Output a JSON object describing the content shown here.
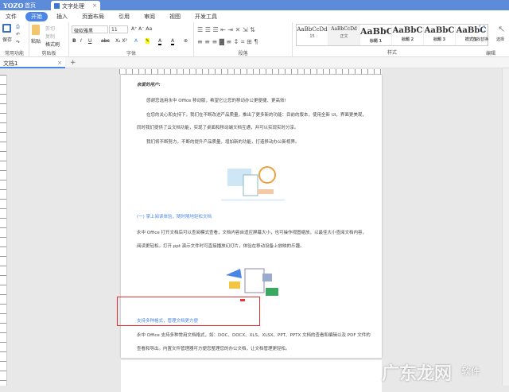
{
  "titlebar": {
    "logo": "YOZO",
    "home": "首页",
    "doc_tab": "文字处理"
  },
  "menu": [
    "文件",
    "开始",
    "插入",
    "页面布局",
    "引用",
    "审阅",
    "视图",
    "开发工具"
  ],
  "ribbon": {
    "common": {
      "save": "保存",
      "label": "常用功能"
    },
    "clipboard": {
      "paste": "粘贴",
      "cut": "剪切",
      "copy": "复制",
      "format_painter": "格式刷",
      "label": "剪贴板"
    },
    "font": {
      "name": "微软雅黑",
      "size": "11",
      "label": "字体"
    },
    "paragraph": {
      "label": "段落"
    },
    "styles": {
      "items": [
        {
          "preview": "AaBbCcDd",
          "name": "15"
        },
        {
          "preview": "AaBbCcDd",
          "name": "正文"
        },
        {
          "preview": "AaBbC",
          "name": "标题 1"
        },
        {
          "preview": "AaBbC",
          "name": "标题 2"
        },
        {
          "preview": "AaBbC",
          "name": "标题 3"
        },
        {
          "preview": "AaBbC",
          "name": "样式 1"
        }
      ],
      "label": "样式"
    },
    "edit": {
      "find_replace": "查找替换",
      "select": "选择",
      "label": "编辑"
    }
  },
  "file_tab": {
    "name": "文档1"
  },
  "document": {
    "salutation": "亲爱的用户:",
    "p1": "感谢您选用永中 Office 移动版，希望它让您的移动办公更便捷、更高效!",
    "p2a": "在您的关心和支持下，我们在不断改进产品质量，推出了更多新的功能：目前的版本，使用全新 UI，界面更美观，",
    "p2b": "同时我们提供了云文档功能，实现了桌面和移动端文档互通，并可以实现实时分享。",
    "p3": "我们将不断努力，不断的提升产品质量，增加新的功能，打造移动办公新视界。",
    "h1": "(一) 掌上阅读体验，随时随地轻松文档",
    "p4a": "永中 Office 打开文档后可以查阅模式查看，文档内容自适应屏幕大小，也可操作视图缩放，以最佳大小查阅文档内容，",
    "p4b": "阅读更轻松。打开 ppt 演示文件时可直接播放幻灯片，体验在移动设备上放映的乐趣。",
    "h2": "支持多种格式，管理文档更方便",
    "p5a": "永中 Office 支持多种常用文档格式，如：DOC、DOCX、XLS、XLSX、PPT、PPTX 文档的查看和编辑以及 PDF 文件的",
    "p5b": "查看和导出。内置文件管理器可方便您整理您的办公文档，让文档管理更轻松。"
  },
  "watermark": "广东龙网",
  "watermark2": "软件"
}
